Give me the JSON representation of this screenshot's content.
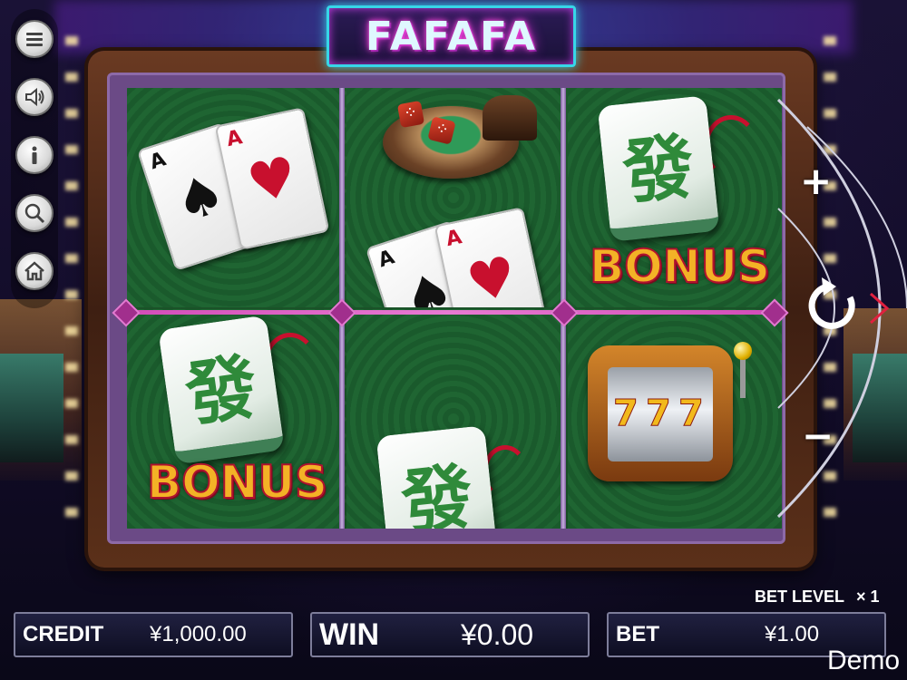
{
  "game": {
    "title": "FAFAFA"
  },
  "menu": [
    {
      "name": "menu-icon"
    },
    {
      "name": "sound-icon"
    },
    {
      "name": "info-icon"
    },
    {
      "name": "zoom-icon"
    },
    {
      "name": "home-icon"
    }
  ],
  "reels": {
    "symbols": {
      "card_rank": "A",
      "tile_glyph": "發",
      "bonus_text": "BONUS",
      "slot_sevens": [
        "7",
        "7",
        "7"
      ]
    }
  },
  "controls": {
    "plus_label": "+",
    "minus_label": "−",
    "spin_icon": "refresh-icon",
    "next_icon": "chevron-right-icon"
  },
  "status": {
    "bet_level_label": "BET LEVEL",
    "bet_level_value": "× 1",
    "credit_label": "CREDIT",
    "credit_value": "¥1,000.00",
    "win_label": "WIN",
    "win_value": "¥0.00",
    "bet_label": "BET",
    "bet_value": "¥1.00",
    "mode": "Demo"
  },
  "colors": {
    "felt": "#1d5a2c",
    "payline": "#d24ab7",
    "bonus_gold": "#f3b226",
    "logo_neon": "#37d6e8"
  }
}
